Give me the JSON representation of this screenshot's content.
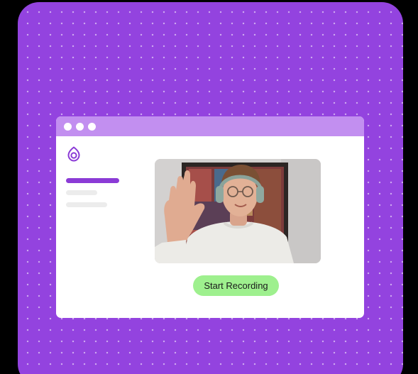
{
  "colors": {
    "background": "#9343df",
    "titlebar": "#c28ff0",
    "accent": "#8b3bd6",
    "button": "#9ef08e",
    "placeholder": "#ececec"
  },
  "icons": {
    "logo": "location-pin-logo-icon"
  },
  "video": {
    "description_icon": "webcam-preview-person-waving"
  },
  "recording": {
    "button_label": "Start Recording"
  }
}
